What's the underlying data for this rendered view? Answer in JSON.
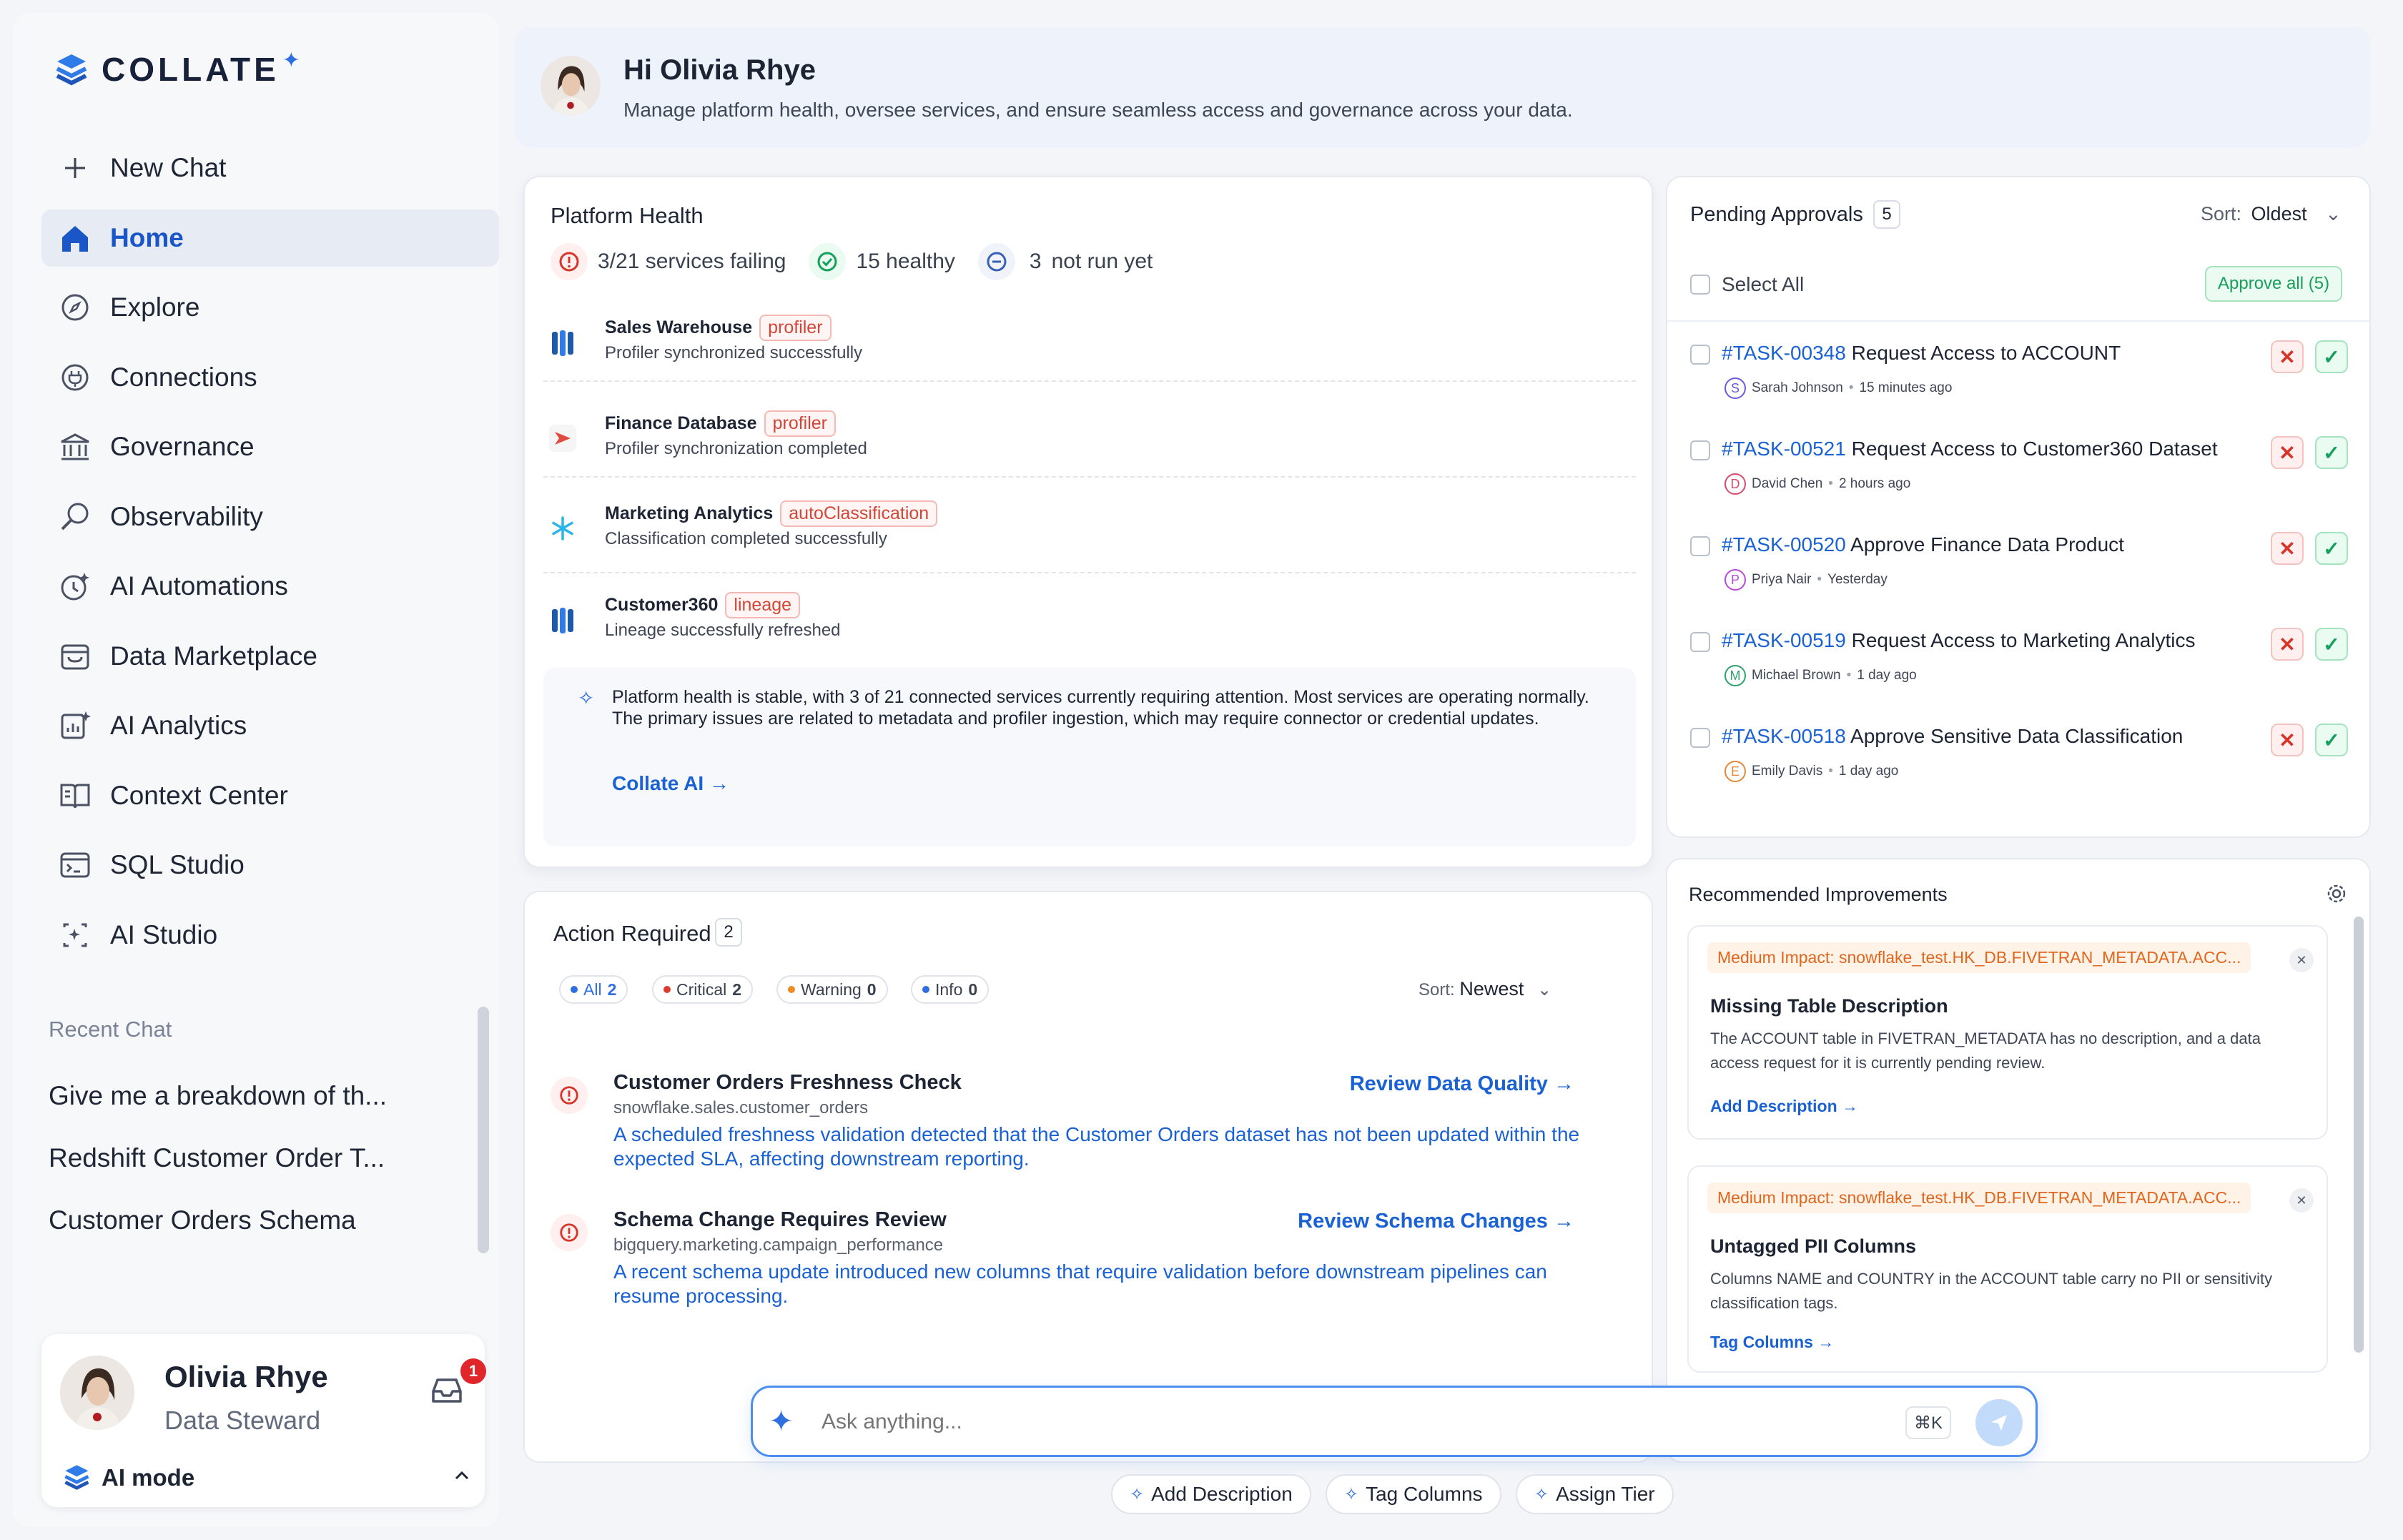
{
  "brand": {
    "name": "COLLATE"
  },
  "sidebar": {
    "items": [
      {
        "label": "New Chat",
        "icon": "plus-icon"
      },
      {
        "label": "Home",
        "icon": "home-icon",
        "active": true
      },
      {
        "label": "Explore",
        "icon": "compass-icon"
      },
      {
        "label": "Connections",
        "icon": "plug-icon"
      },
      {
        "label": "Governance",
        "icon": "bank-icon"
      },
      {
        "label": "Observability",
        "icon": "magnifier-icon"
      },
      {
        "label": "AI Automations",
        "icon": "automation-icon"
      },
      {
        "label": "Data Marketplace",
        "icon": "store-icon"
      },
      {
        "label": "AI Analytics",
        "icon": "analytics-icon"
      },
      {
        "label": "Context Center",
        "icon": "book-icon"
      },
      {
        "label": "SQL Studio",
        "icon": "terminal-icon"
      },
      {
        "label": "AI Studio",
        "icon": "ai-studio-icon"
      }
    ],
    "recent_heading": "Recent Chat",
    "recent": [
      "Give me a breakdown of th...",
      "Redshift Customer Order T...",
      "Customer Orders Schema"
    ]
  },
  "user": {
    "name": "Olivia Rhye",
    "role": "Data Steward",
    "notifications": "1",
    "mode": "AI mode"
  },
  "header": {
    "greeting": "Hi Olivia Rhye",
    "subtitle": "Manage platform health, oversee services, and ensure seamless access and governance across your data."
  },
  "platform_health": {
    "title": "Platform Health",
    "stats": {
      "failing": "3/21 services failing",
      "healthy": "15 healthy",
      "not_run_num": "3",
      "not_run": "not run yet"
    },
    "services": [
      {
        "name": "Sales Warehouse",
        "tag": "profiler",
        "status": "Profiler synchronized successfully",
        "icon": "db-icon"
      },
      {
        "name": "Finance Database",
        "tag": "profiler",
        "status": "Profiler synchronization completed",
        "icon": "redshift-icon"
      },
      {
        "name": "Marketing Analytics",
        "tag": "autoClassification",
        "status": "Classification completed successfully",
        "icon": "snowflake-icon"
      },
      {
        "name": "Customer360",
        "tag": "lineage",
        "status": "Lineage successfully refreshed",
        "icon": "db-icon"
      }
    ],
    "ai_summary": "Platform health is stable, with 3 of 21 connected services currently requiring attention. Most services are operating normally. The primary issues are related to metadata and profiler ingestion, which may require connector or credential updates.",
    "ai_link": "Collate AI →"
  },
  "action_required": {
    "title": "Action Required",
    "count": "2",
    "filters": [
      {
        "label": "All",
        "count": "2",
        "color": "#2f6fe0"
      },
      {
        "label": "Critical",
        "count": "2",
        "color": "#e03a2f"
      },
      {
        "label": "Warning",
        "count": "0",
        "color": "#f08a24"
      },
      {
        "label": "Info",
        "count": "0",
        "color": "#2f6fe0"
      }
    ],
    "sort_label": "Sort:",
    "sort_value": "Newest",
    "items": [
      {
        "title": "Customer Orders Freshness Check",
        "path": "snowflake.sales.customer_orders",
        "desc": "A scheduled freshness validation detected that the Customer Orders dataset has not been updated within the expected SLA, affecting downstream reporting.",
        "action": "Review Data Quality →"
      },
      {
        "title": "Schema Change Requires Review",
        "path": "bigquery.marketing.campaign_performance",
        "desc": "A recent schema update introduced new columns that require validation before downstream pipelines can resume processing.",
        "action": "Review Schema Changes →"
      }
    ]
  },
  "pending": {
    "title": "Pending Approvals",
    "count": "5",
    "sort_label": "Sort:",
    "sort_value": "Oldest",
    "select_all": "Select All",
    "approve_all": "Approve all (5)",
    "items": [
      {
        "id": "#TASK-00348",
        "text": "Request Access to ACCOUNT",
        "initial": "S",
        "user": "Sarah Johnson",
        "time": "15 minutes ago",
        "color": "#6b5bd6"
      },
      {
        "id": "#TASK-00521",
        "text": "Request Access to Customer360 Dataset",
        "initial": "D",
        "user": "David Chen",
        "time": "2 hours ago",
        "color": "#d64b6b"
      },
      {
        "id": "#TASK-00520",
        "text": "Approve Finance Data Product",
        "initial": "P",
        "user": "Priya Nair",
        "time": "Yesterday",
        "color": "#b84bd6"
      },
      {
        "id": "#TASK-00519",
        "text": "Request Access to Marketing Analytics",
        "initial": "M",
        "user": "Michael Brown",
        "time": "1 day ago",
        "color": "#2ea36a"
      },
      {
        "id": "#TASK-00518",
        "text": "Approve Sensitive Data Classification",
        "initial": "E",
        "user": "Emily Davis",
        "time": "1 day ago",
        "color": "#e08a3a"
      }
    ]
  },
  "recommended": {
    "title": "Recommended Improvements",
    "items": [
      {
        "impact": "Medium Impact: snowflake_test.HK_DB.FIVETRAN_METADATA.ACC...",
        "title": "Missing Table Description",
        "desc": "The ACCOUNT table in FIVETRAN_METADATA has no description, and a data access request for it is currently pending review.",
        "action": "Add Description →"
      },
      {
        "impact": "Medium Impact: snowflake_test.HK_DB.FIVETRAN_METADATA.ACC...",
        "title": "Untagged PII Columns",
        "desc": "Columns NAME and COUNTRY in the ACCOUNT table carry no PII or sensitivity classification tags.",
        "action": "Tag Columns →"
      }
    ]
  },
  "chat": {
    "placeholder": "Ask anything...",
    "shortcut": "⌘K",
    "quick_actions": [
      "Add Description",
      "Tag Columns",
      "Assign Tier"
    ]
  }
}
